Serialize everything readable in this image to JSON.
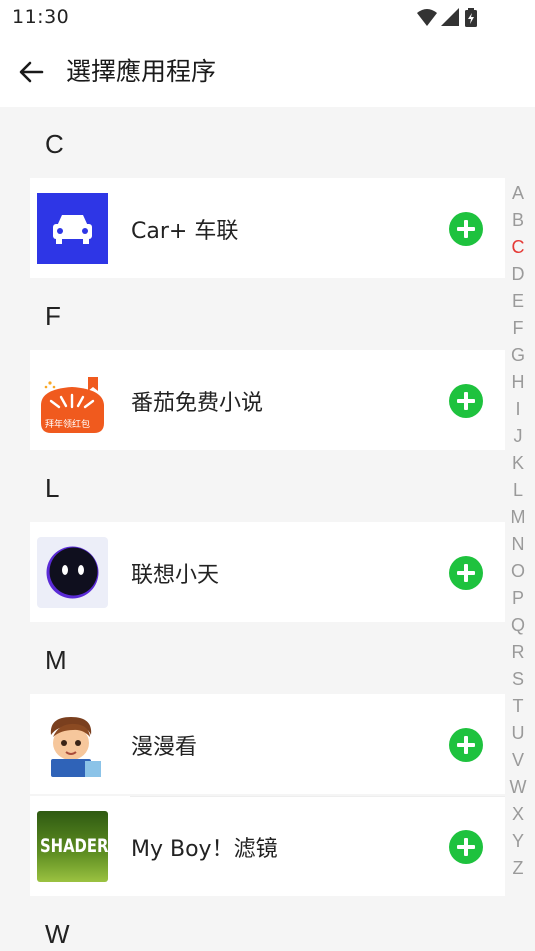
{
  "status_bar": {
    "time": "11:30",
    "icons": [
      "wifi-icon",
      "signal-icon",
      "battery-charging-icon"
    ]
  },
  "app_bar": {
    "back_icon": "arrow-left-icon",
    "title": "選擇應用程序"
  },
  "sections": [
    {
      "letter": "C",
      "apps": [
        {
          "name": "Car+ 车联",
          "icon": "car-app-icon"
        }
      ]
    },
    {
      "letter": "F",
      "apps": [
        {
          "name": "番茄免费小说",
          "icon": "tomato-novel-app-icon",
          "icon_badge_text": "拜年领红包"
        }
      ]
    },
    {
      "letter": "L",
      "apps": [
        {
          "name": "联想小天",
          "icon": "lenovo-xiaotian-app-icon"
        }
      ]
    },
    {
      "letter": "M",
      "apps": [
        {
          "name": "漫漫看",
          "icon": "manmankan-app-icon"
        },
        {
          "name": "My Boy！滤镜",
          "icon": "shader-app-icon",
          "icon_text": "SHADER"
        }
      ]
    },
    {
      "letter": "W",
      "apps": []
    }
  ],
  "add_icon": "plus-circle-icon",
  "colors": {
    "add_button": "#1ec23e",
    "index_active": "#e53935",
    "index_inactive": "#9a9a9a",
    "car_icon_bg": "#2e36e6"
  },
  "index_bar": {
    "letters": [
      "A",
      "B",
      "C",
      "D",
      "E",
      "F",
      "G",
      "H",
      "I",
      "J",
      "K",
      "L",
      "M",
      "N",
      "O",
      "P",
      "Q",
      "R",
      "S",
      "T",
      "U",
      "V",
      "W",
      "X",
      "Y",
      "Z"
    ],
    "active": "C"
  }
}
